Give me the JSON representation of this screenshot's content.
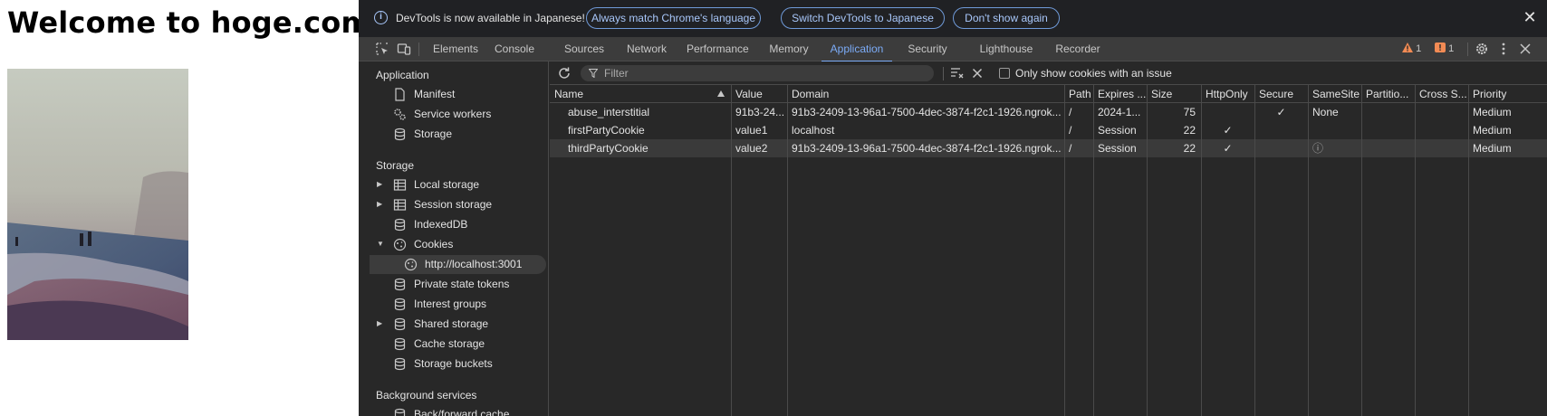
{
  "page": {
    "heading": "Welcome to hoge.com"
  },
  "infobar": {
    "message": "DevTools is now available in Japanese!",
    "btn_match": "Always match Chrome's language",
    "btn_switch": "Switch DevTools to Japanese",
    "btn_dismiss": "Don't show again"
  },
  "tabs": [
    "Elements",
    "Console",
    "Sources",
    "Network",
    "Performance",
    "Memory",
    "Application",
    "Security",
    "Lighthouse",
    "Recorder"
  ],
  "active_tab": "Application",
  "badges": {
    "warnings": "1",
    "issues": "1"
  },
  "sidebar": {
    "application_header": "Application",
    "application_items": [
      "Manifest",
      "Service workers",
      "Storage"
    ],
    "storage_header": "Storage",
    "storage_items": [
      "Local storage",
      "Session storage",
      "IndexedDB",
      "Cookies",
      "http://localhost:3001",
      "Private state tokens",
      "Interest groups",
      "Shared storage",
      "Cache storage",
      "Storage buckets"
    ],
    "background_header": "Background services",
    "background_items": [
      "Back/forward cache"
    ]
  },
  "toolbar": {
    "filter_placeholder": "Filter",
    "only_issues_label": "Only show cookies with an issue"
  },
  "columns": [
    "Name",
    "Value",
    "Domain",
    "Path",
    "Expires ...",
    "Size",
    "HttpOnly",
    "Secure",
    "SameSite",
    "Partitio...",
    "Cross S...",
    "Priority"
  ],
  "cookies": [
    {
      "name": "abuse_interstitial",
      "value": "91b3-24...",
      "domain": "91b3-2409-13-96a1-7500-4dec-3874-f2c1-1926.ngrok...",
      "path": "/",
      "expires": "2024-1...",
      "size": "75",
      "httponly": "",
      "secure": "✓",
      "samesite": "None",
      "partition": "",
      "cross": "",
      "priority": "Medium"
    },
    {
      "name": "firstPartyCookie",
      "value": "value1",
      "domain": "localhost",
      "path": "/",
      "expires": "Session",
      "size": "22",
      "httponly": "✓",
      "secure": "",
      "samesite": "",
      "partition": "",
      "cross": "",
      "priority": "Medium"
    },
    {
      "name": "thirdPartyCookie",
      "value": "value2",
      "domain": "91b3-2409-13-96a1-7500-4dec-3874-f2c1-1926.ngrok...",
      "path": "/",
      "expires": "Session",
      "size": "22",
      "httponly": "✓",
      "secure": "",
      "samesite": "ⓘ",
      "partition": "",
      "cross": "",
      "priority": "Medium"
    }
  ],
  "colors": {
    "accent": "#7cacf8",
    "background": "#282828",
    "warning": "#f28b54",
    "error": "#f28b54"
  }
}
